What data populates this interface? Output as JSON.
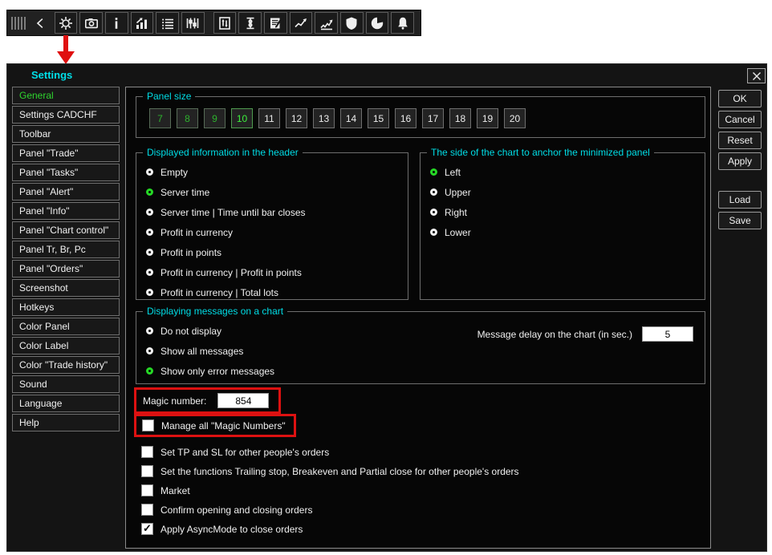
{
  "toolbar": {
    "icon_names": [
      "grip-handle",
      "collapse-chevron",
      "settings-gear",
      "camera",
      "info",
      "bar-chart",
      "list",
      "candlestick-settings",
      "doc-transfer",
      "column-spread",
      "notepad-edit",
      "trend-arrow",
      "trend-zigzag",
      "shield",
      "pie-chart",
      "bell"
    ]
  },
  "annotations": {
    "arrow_color": "#e01010",
    "highlight_color": "#dd1111"
  },
  "dialog": {
    "title": "Settings",
    "sidebar": {
      "items": [
        {
          "label": "General",
          "selected": true
        },
        {
          "label": "Settings CADCHF",
          "selected": false
        },
        {
          "label": "Toolbar",
          "selected": false
        },
        {
          "label": "Panel \"Trade\"",
          "selected": false
        },
        {
          "label": "Panel \"Tasks\"",
          "selected": false
        },
        {
          "label": "Panel \"Alert\"",
          "selected": false
        },
        {
          "label": "Panel \"Info\"",
          "selected": false
        },
        {
          "label": "Panel \"Chart control\"",
          "selected": false
        },
        {
          "label": "Panel Tr, Br, Pc",
          "selected": false
        },
        {
          "label": "Panel \"Orders\"",
          "selected": false
        },
        {
          "label": "Screenshot",
          "selected": false
        },
        {
          "label": "Hotkeys",
          "selected": false
        },
        {
          "label": "Color Panel",
          "selected": false
        },
        {
          "label": "Color Label",
          "selected": false
        },
        {
          "label": "Color \"Trade history\"",
          "selected": false
        },
        {
          "label": "Sound",
          "selected": false
        },
        {
          "label": "Language",
          "selected": false
        },
        {
          "label": "Help",
          "selected": false
        }
      ]
    },
    "actions": {
      "primary": [
        "OK",
        "Cancel",
        "Reset",
        "Apply"
      ],
      "file": [
        "Load",
        "Save"
      ]
    },
    "panel_size": {
      "legend": "Panel size",
      "options": [
        "7",
        "8",
        "9",
        "10",
        "11",
        "12",
        "13",
        "14",
        "15",
        "16",
        "17",
        "18",
        "19",
        "20"
      ],
      "green_options": [
        "7",
        "8",
        "9"
      ],
      "selected": "10"
    },
    "header_info": {
      "legend": "Displayed information in the header",
      "options": [
        "Empty",
        "Server time",
        "Server time | Time until bar closes",
        "Profit in currency",
        "Profit in points",
        "Profit in currency | Profit in points",
        "Profit in currency | Total lots"
      ],
      "selected": "Server time"
    },
    "anchor_side": {
      "legend": "The side of the chart to anchor the minimized panel",
      "options": [
        "Left",
        "Upper",
        "Right",
        "Lower"
      ],
      "selected": "Left"
    },
    "messages": {
      "legend": "Displaying messages on a chart",
      "options": [
        "Do not display",
        "Show all messages",
        "Show only error messages"
      ],
      "selected": "Show only error messages",
      "delay_label": "Message delay on the chart (in sec.)",
      "delay_value": "5"
    },
    "magic": {
      "label": "Magic number:",
      "value": "854"
    },
    "checkboxes": [
      {
        "label": "Manage all \"Magic Numbers\"",
        "checked": false,
        "highlighted": true
      },
      {
        "label": "Set TP and SL for other people's orders",
        "checked": false
      },
      {
        "label": "Set the functions Trailing stop, Breakeven and Partial close for other people's orders",
        "checked": false
      },
      {
        "label": "Market",
        "checked": false
      },
      {
        "label": "Confirm opening and closing orders",
        "checked": false
      },
      {
        "label": "Apply AsyncMode to close orders",
        "checked": true
      }
    ],
    "colors": {
      "accent_cyan": "#00dde6",
      "selected_green": "#2fd42f",
      "dim_green": "#2db22d"
    }
  }
}
